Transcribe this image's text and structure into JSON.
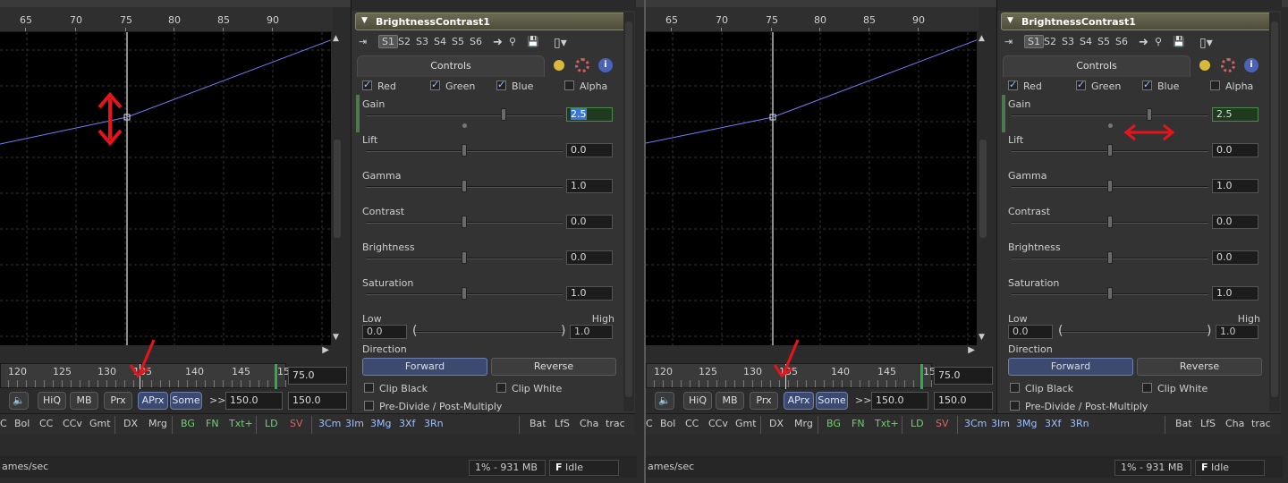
{
  "ruler": {
    "ticks": [
      "65",
      "70",
      "75",
      "80",
      "85",
      "90"
    ]
  },
  "timeline": {
    "ticks": [
      "120",
      "125",
      "130",
      "135",
      "140",
      "145",
      "15"
    ],
    "current_frame": "75.0"
  },
  "playback": {
    "hiq": "HiQ",
    "mb": "MB",
    "prx": "Prx",
    "aprx": "APrx",
    "some": "Some",
    "arrows": ">>",
    "render_end": "150.0",
    "global_end": "150.0"
  },
  "toolbar": {
    "left": [
      "C",
      "Bol",
      "CC",
      "CCv",
      "Gmt"
    ],
    "mid1": [
      "DX",
      "Mrg"
    ],
    "mid2": [
      "BG",
      "FN",
      "Txt+"
    ],
    "mid3": [
      "LD",
      "SV"
    ],
    "mid4": [
      "3Cm",
      "3Im",
      "3Mg",
      "3Xf",
      "3Rn"
    ],
    "right": [
      "Bat",
      "LfS",
      "Cha",
      "trac"
    ]
  },
  "status": {
    "left": "ames/sec",
    "memory": "1% - 931 MB",
    "state_letter": "F",
    "state": "Idle"
  },
  "inspector": {
    "tool_name": "BrightnessContrast1",
    "slots": [
      "S1",
      "S2",
      "S3",
      "S4",
      "S5",
      "S6"
    ],
    "tab": "Controls",
    "channels": {
      "red": "Red",
      "green": "Green",
      "blue": "Blue",
      "alpha": "Alpha"
    },
    "params": [
      {
        "label": "Gain",
        "value": "2.5",
        "position": 0.7
      },
      {
        "label": "Lift",
        "value": "0.0",
        "position": 0.5
      },
      {
        "label": "Gamma",
        "value": "1.0",
        "position": 0.5
      },
      {
        "label": "Contrast",
        "value": "0.0",
        "position": 0.5
      },
      {
        "label": "Brightness",
        "value": "0.0",
        "position": 0.5
      },
      {
        "label": "Saturation",
        "value": "1.0",
        "position": 0.5
      }
    ],
    "low_label": "Low",
    "high_label": "High",
    "low_value": "0.0",
    "high_value": "1.0",
    "direction_label": "Direction",
    "forward": "Forward",
    "reverse": "Reverse",
    "clip_black": "Clip Black",
    "clip_white": "Clip White",
    "premultiply": "Pre-Divide / Post-Multiply"
  },
  "colors": {
    "accent": "#3b4a6e",
    "annotation": "#e8141c",
    "spline": "#6f7fff"
  }
}
